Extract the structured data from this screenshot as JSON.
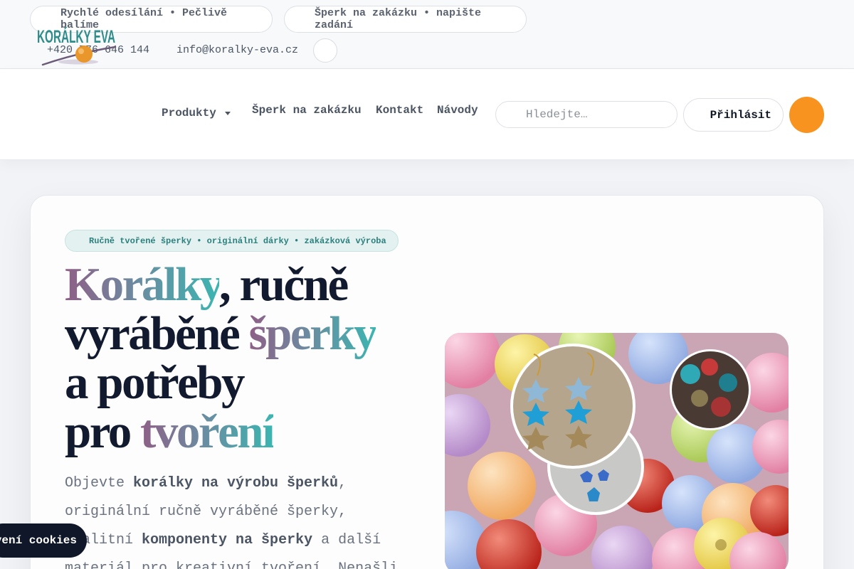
{
  "topbar": {
    "pill_shipping": "Rychlé odesílání • Pečlivě balíme",
    "pill_custom": "Šperk na zakázku • napište zadání",
    "phone": "+420 776 646 144",
    "email": "info@koralky-eva.cz"
  },
  "header": {
    "logo_text": "KORÁLKY EVA",
    "nav": {
      "produkty": "Produkty",
      "zakazka": "Šperk na zakázku",
      "kontakt": "Kontakt",
      "navody": "Návody"
    },
    "search_placeholder": "Hledejte…",
    "login_label": "Přihlásit",
    "cart_color": "#f7931e"
  },
  "hero": {
    "tagline": "Ručně tvořené šperky • originální dárky • zakázková výroba",
    "headline": {
      "w1": "Korálky",
      "w2": ", ručně",
      "w3": "vyráběné ",
      "w4": "šperky",
      "w5": "a potřeby",
      "w6": "pro ",
      "w7": "tvoření"
    },
    "intro": {
      "p1": "Objevte ",
      "b1": "korálky na výrobu šperků",
      "p2": ", originální ručně vyráběné šperky, kvalitní ",
      "b2": "komponenty na šperky",
      "p3": " a další materiál pro kreativní tvoření. Nenašli"
    }
  },
  "cookie": {
    "label": "Nastavení cookies"
  },
  "colors": {
    "accent": "#2f8c8a",
    "orange": "#f7931e",
    "dark": "#111a2e"
  }
}
